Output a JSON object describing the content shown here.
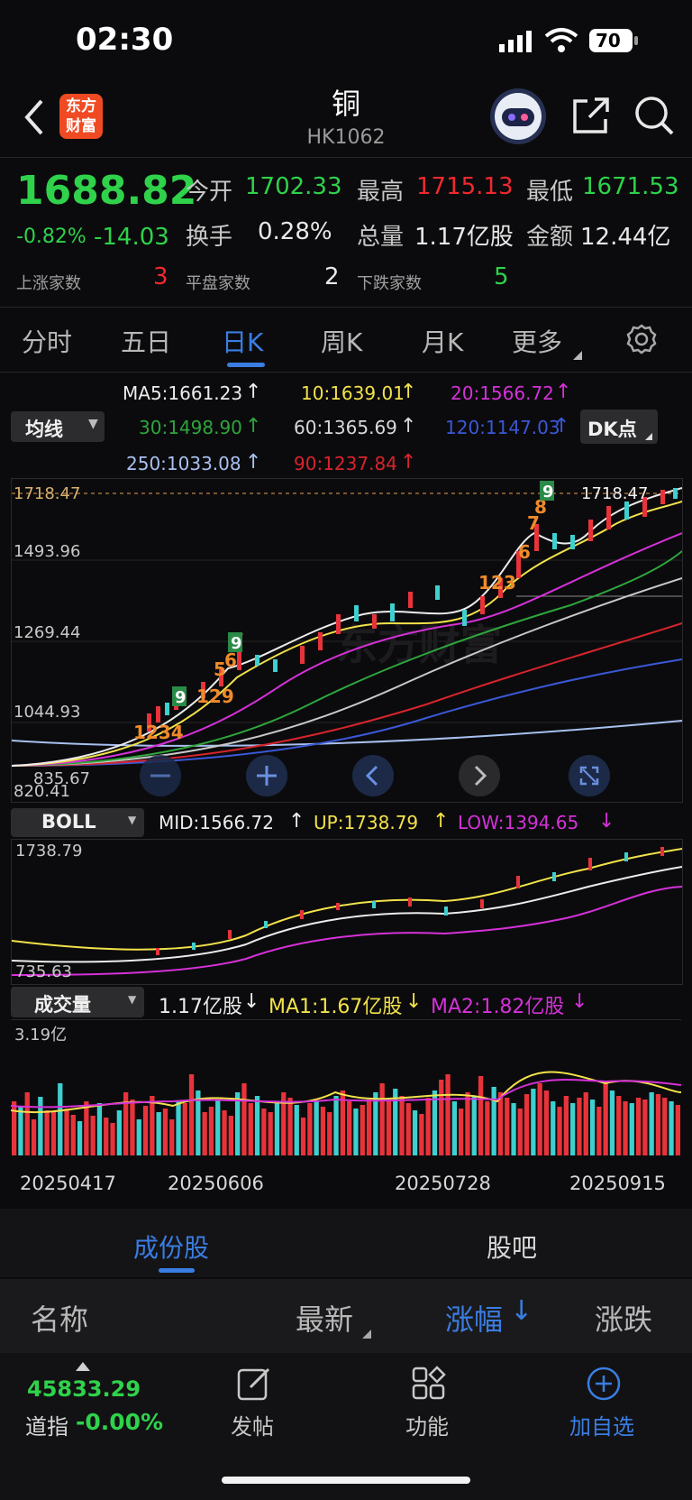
{
  "status_bar": {
    "time": "02:30",
    "battery": "70"
  },
  "header": {
    "name": "铜",
    "code": "HK1062",
    "logo_line1": "东方",
    "logo_line2": "财富"
  },
  "quote": {
    "price": "1688.82",
    "change_pct": "-0.82%",
    "change": "-14.03",
    "open_label": "今开",
    "open": "1702.33",
    "high_label": "最高",
    "high": "1715.13",
    "low_label": "最低",
    "low": "1671.53",
    "turnover_label": "换手",
    "turnover": "0.28%",
    "volume_label": "总量",
    "volume": "1.17亿股",
    "amount_label": "金额",
    "amount": "12.44亿",
    "up_label": "上涨家数",
    "up": "3",
    "flat_label": "平盘家数",
    "flat": "2",
    "down_label": "下跌家数",
    "down": "5"
  },
  "tabs": [
    "分时",
    "五日",
    "日K",
    "周K",
    "月K",
    "更多"
  ],
  "ma_legend": {
    "dropdown": "均线",
    "ma5": "MA5:1661.23",
    "ma10": "10:1639.01",
    "ma20": "20:1566.72",
    "ma30": "30:1498.90",
    "ma60": "60:1365.69",
    "ma120": "120:1147.03",
    "ma250": "250:1033.08",
    "ma90": "90:1237.84",
    "dk_button": "DK点"
  },
  "colors": {
    "ma5": "#ececec",
    "ma10": "#f2e24a",
    "ma20": "#d531d8",
    "ma30": "#2ea63c",
    "ma60": "#c8c8c8",
    "ma120": "#3b58d8",
    "ma250": "#a8c0f0",
    "ma90": "#d8242c",
    "up": "#f0292f",
    "down": "#2fd24a",
    "candle_up": "#e8333a",
    "candle_down": "#3ecfcf"
  },
  "kchart": {
    "last_price_tag": "1718.47",
    "y_ticks": [
      "1718.47",
      "1493.96",
      "1269.44",
      "1044.93",
      "835.67",
      "820.41"
    ]
  },
  "boll": {
    "dropdown": "BOLL",
    "mid": "MID:1566.72",
    "up": "UP:1738.79",
    "low": "LOW:1394.65",
    "y_ticks": [
      "1738.79",
      "735.63"
    ]
  },
  "volume": {
    "dropdown": "成交量",
    "value": "1.17亿股",
    "ma1": "MA1:1.67亿股",
    "ma2": "MA2:1.82亿股",
    "y_tick": "3.19亿"
  },
  "dates": [
    "20250417",
    "20250606",
    "20250728",
    "20250915"
  ],
  "bottom_tabs": {
    "constituents": "成份股",
    "forum": "股吧"
  },
  "columns": {
    "name": "名称",
    "latest": "最新",
    "change_pct": "涨幅",
    "change": "涨跌"
  },
  "toolbar": {
    "index_value": "45833.29",
    "index_name": "道指",
    "index_change": "-0.00%",
    "post": "发帖",
    "functions": "功能",
    "add_watch": "加自选"
  }
}
